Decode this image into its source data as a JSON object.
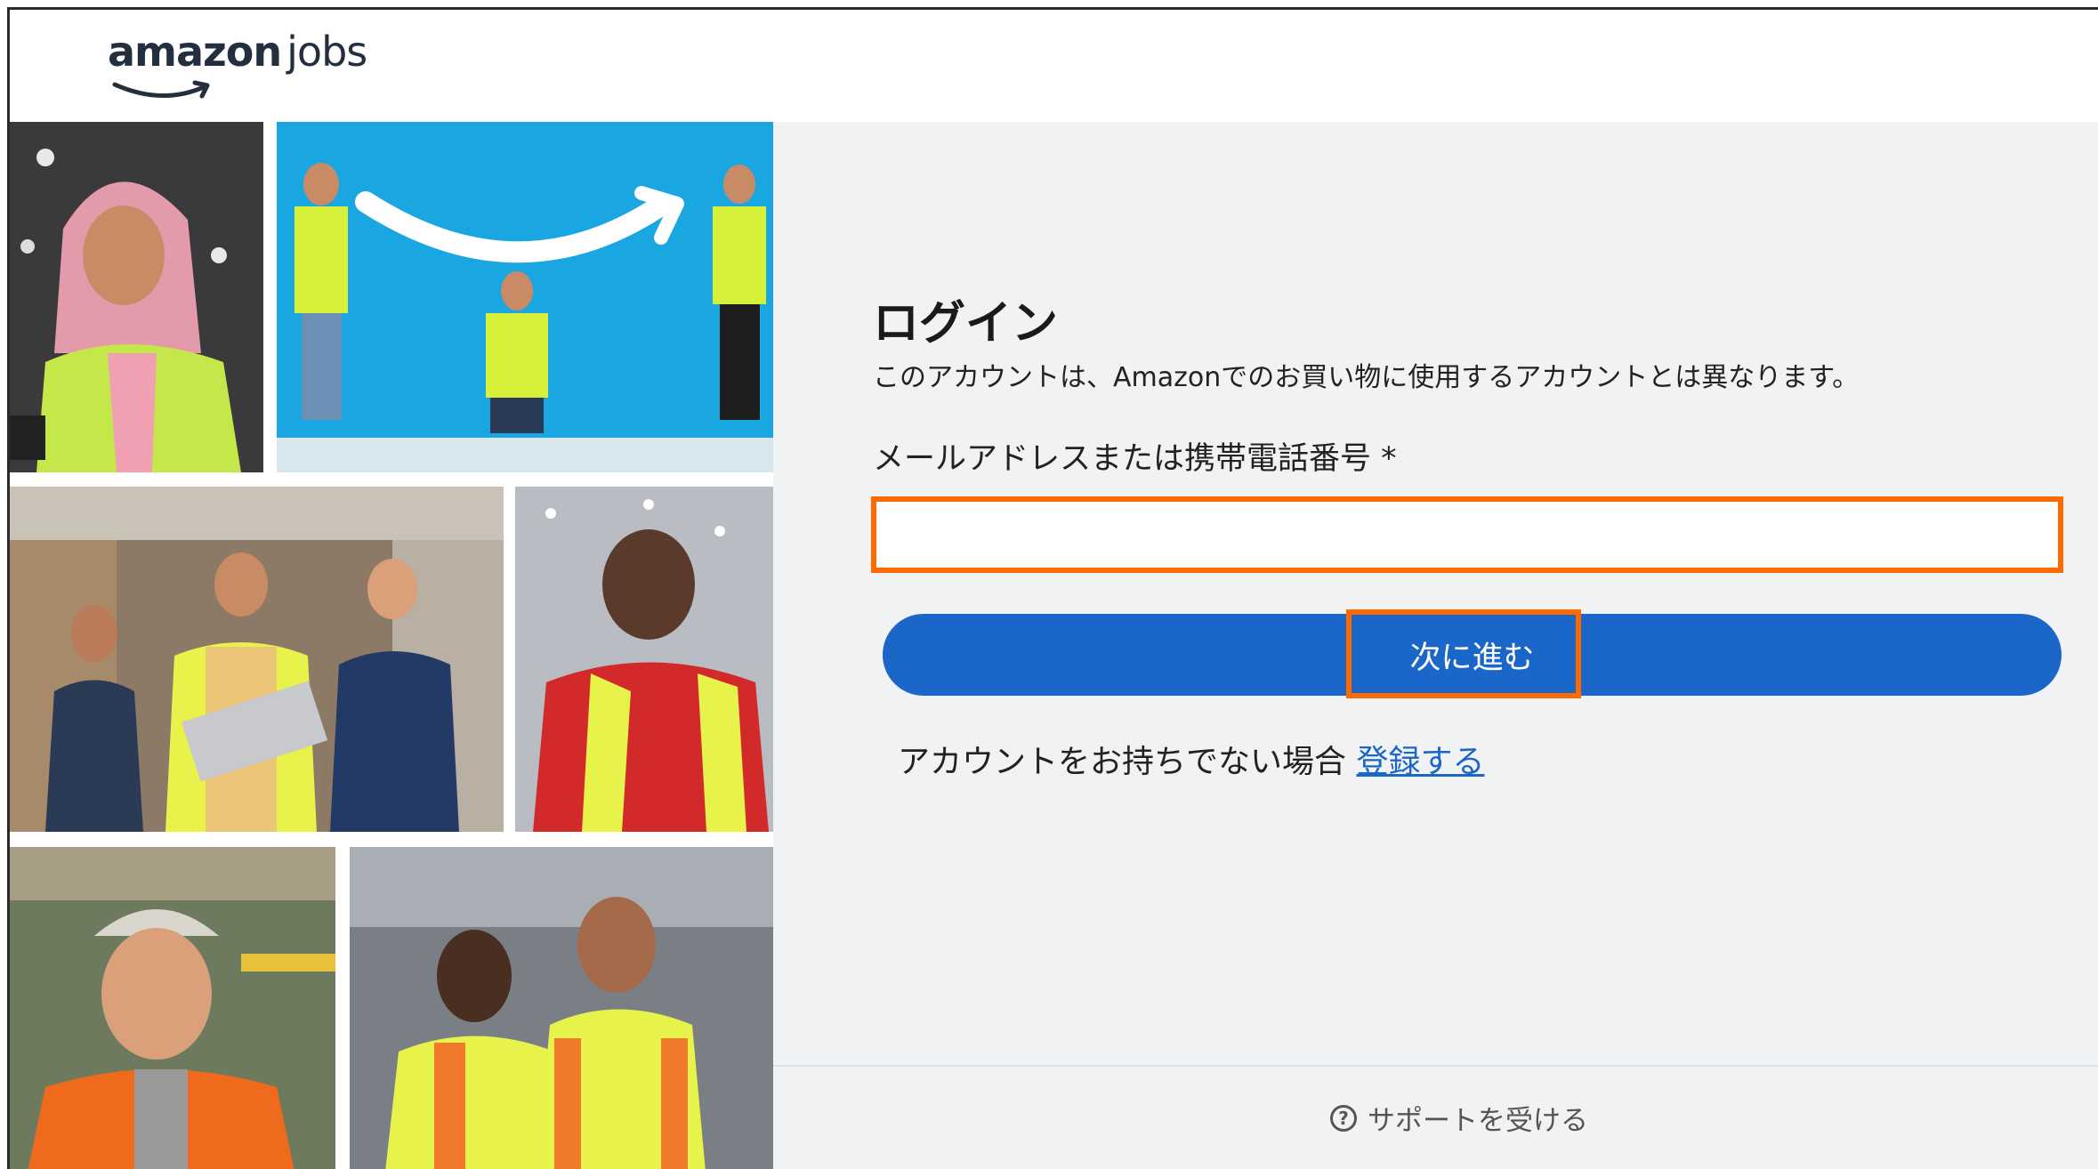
{
  "header": {
    "logo_primary": "amazon",
    "logo_secondary": "jobs"
  },
  "login": {
    "title": "ログイン",
    "subtitle": "このアカウントは、Amazonでのお買い物に使用するアカウントとは異なります。",
    "field_label": "メールアドレスまたは携帯電話番号 *",
    "field_value": "",
    "next_label": "次に進む",
    "signup_prompt": "アカウントをお持ちでない場合",
    "signup_link": "登録する"
  },
  "footer": {
    "support_label": "サポートを受ける"
  },
  "colors": {
    "accent_blue": "#1a66c9",
    "highlight_orange": "#ff6a00",
    "panel_bg": "#f0f2f4",
    "hero_blue": "#1aa6e0"
  },
  "icons": {
    "help": "question-circle-icon",
    "logo_smile": "amazon-smile-icon"
  }
}
